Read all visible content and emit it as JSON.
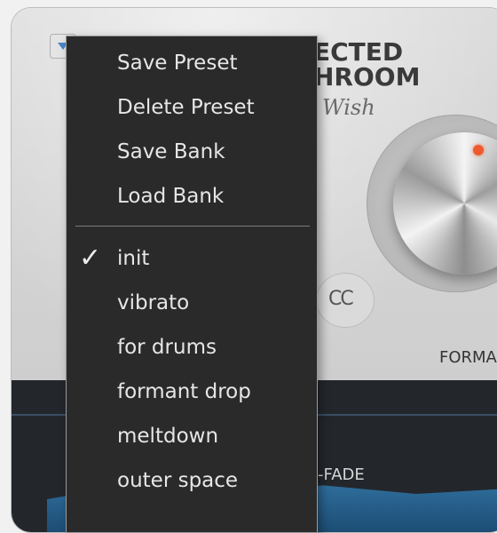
{
  "plugin": {
    "logo_line1": "ECTED",
    "logo_line2": "HROOM",
    "logo_line3": "Wish",
    "knob_label": "FORMAN",
    "link_icon_glyph": "CC",
    "crossfade_label": "-FADE",
    "accent_dot_color": "#ee5a2f"
  },
  "menu": {
    "actions": [
      {
        "label": "Save Preset"
      },
      {
        "label": "Delete Preset"
      },
      {
        "label": "Save Bank"
      },
      {
        "label": "Load Bank"
      }
    ],
    "presets": [
      {
        "label": "init",
        "checked": true
      },
      {
        "label": "vibrato",
        "checked": false
      },
      {
        "label": "for drums",
        "checked": false
      },
      {
        "label": "formant drop",
        "checked": false
      },
      {
        "label": "meltdown",
        "checked": false
      },
      {
        "label": "outer space",
        "checked": false
      }
    ],
    "check_glyph": "✓"
  }
}
